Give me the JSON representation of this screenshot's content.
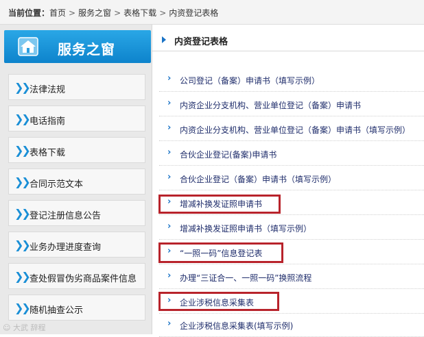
{
  "breadcrumb": {
    "label": "当前位置：",
    "items": [
      "首页",
      "服务之窗",
      "表格下载",
      "内资登记表格"
    ]
  },
  "sidebar": {
    "title": "服务之窗",
    "items": [
      {
        "label": "法律法规"
      },
      {
        "label": "电话指南"
      },
      {
        "label": "表格下载"
      },
      {
        "label": "合同示范文本"
      },
      {
        "label": "登记注册信息公告"
      },
      {
        "label": "业务办理进度查询"
      },
      {
        "label": "查处假冒伪劣商品案件信息"
      },
      {
        "label": "随机抽查公示"
      }
    ]
  },
  "main": {
    "title": "内资登记表格",
    "links": [
      {
        "label": "公司登记（备案）申请书（填写示例）",
        "highlighted": false
      },
      {
        "label": "内资企业分支机构、营业单位登记（备案）申请书",
        "highlighted": false
      },
      {
        "label": "内资企业分支机构、营业单位登记（备案）申请书（填写示例）",
        "highlighted": false
      },
      {
        "label": "合伙企业登记(备案)申请书",
        "highlighted": false
      },
      {
        "label": "合伙企业登记（备案）申请书（填写示例）",
        "highlighted": false
      },
      {
        "label": "增减补换发证照申请书",
        "highlighted": true
      },
      {
        "label": "增减补换发证照申请书（填写示例）",
        "highlighted": false
      },
      {
        "label": "“一照一码”信息登记表",
        "highlighted": true
      },
      {
        "label": "办理“三证合一、一照一码”换照流程",
        "highlighted": false
      },
      {
        "label": "企业涉税信息采集表",
        "highlighted": true
      },
      {
        "label": "企业涉税信息采集表(填写示例)",
        "highlighted": false
      }
    ]
  },
  "colors": {
    "accent": "#1a8fd6",
    "link": "#1f2d6b",
    "highlight_box": "#b8232b"
  },
  "icons": {
    "home": "home-icon",
    "item_chevron": "double-chevron-right-icon",
    "link_arrow": "chevron-right-icon"
  }
}
